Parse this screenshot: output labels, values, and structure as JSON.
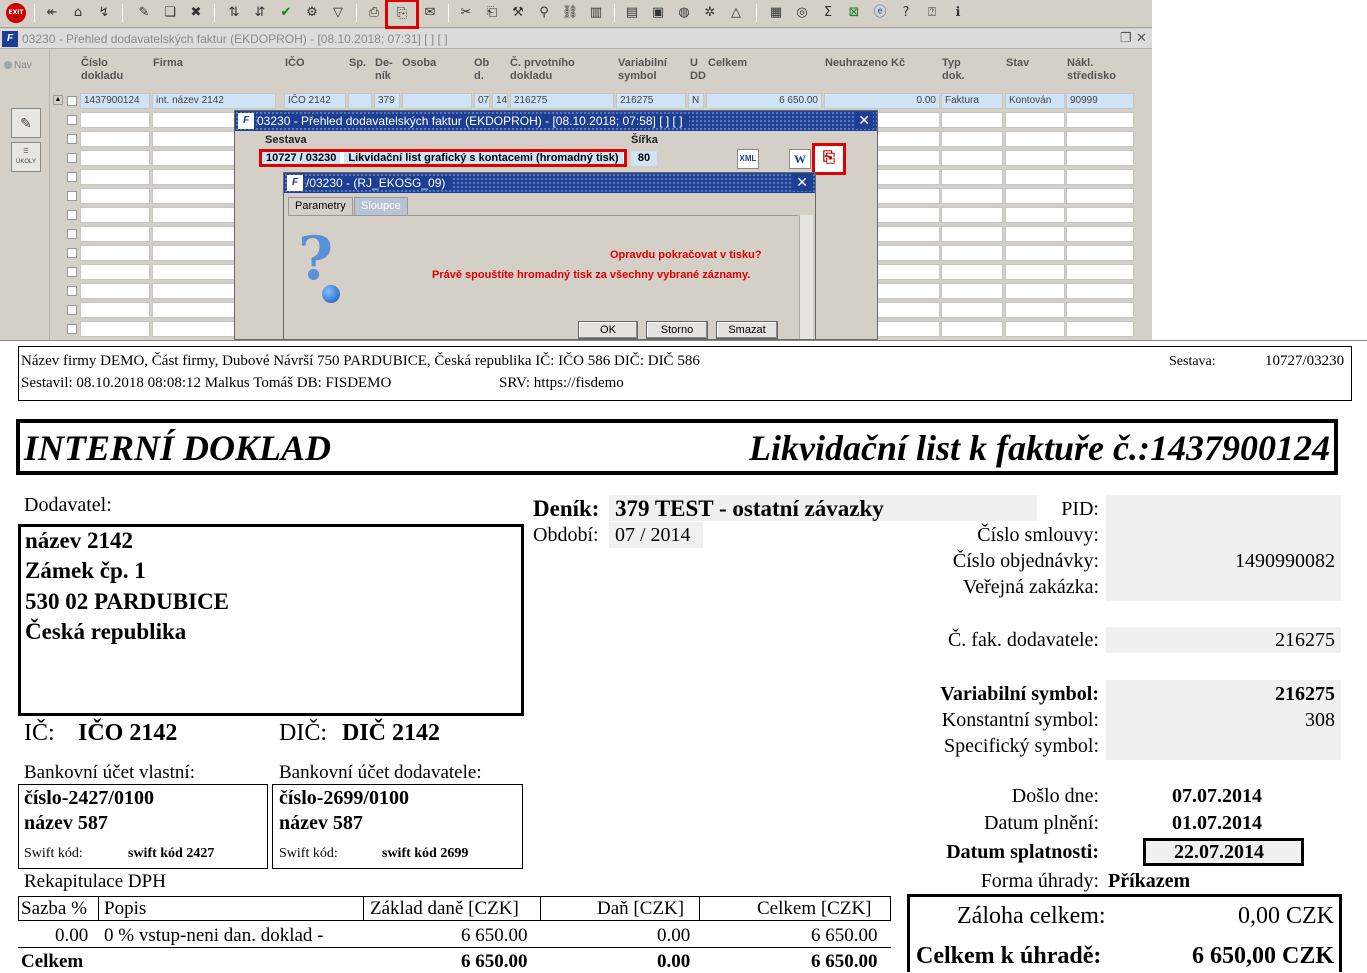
{
  "toolbar": {
    "exit_label": "EXIT",
    "icons": [
      "back-icon",
      "forward-icon",
      "refresh-icon",
      "edit-icon",
      "new-icon",
      "copy-icon",
      "delete-icon",
      "sort-asc-icon",
      "sort-desc-icon",
      "check-icon",
      "settings-icon",
      "filter-icon",
      "print-icon",
      "print-preview-icon",
      "mail-icon",
      "cut-icon",
      "paste-icon",
      "tools-icon",
      "search-icon",
      "link-icon",
      "columns-icon",
      "export-icon",
      "save-icon",
      "globe-icon",
      "tree-icon",
      "chart-icon",
      "report-icon",
      "calc-icon",
      "sum-icon",
      "excel-icon",
      "ie-icon",
      "help-icon",
      "help2-icon",
      "info-icon"
    ]
  },
  "window": {
    "title": "03230 - Přehled dodavatelských faktur (EKDOPROH) - [08.10.2018; 07:31]  [ ]  [ ]",
    "nav_label": "Nav",
    "ukoly_label": "ÚKOLY"
  },
  "grid": {
    "headers": [
      "Číslo\ndokladu",
      "Firma",
      "IČO",
      "Sp.",
      "De-\nník",
      "Osoba",
      "Ob\nd.",
      "Č. prvotního\ndokladu",
      "Variabilní\nsymbol",
      "U\nDD",
      "Celkem",
      "Neuhrazeno Kč",
      "Typ\ndok.",
      "Stav",
      "Nákl.\nstředisko"
    ],
    "row": [
      "1437900124",
      "int. název 2142",
      "IČO 2142",
      "",
      "379",
      "",
      "07",
      "14",
      "216275",
      "216275",
      "N",
      "6 650.00",
      "0.00",
      "Faktura",
      "Kontován",
      "90999"
    ]
  },
  "dialog1": {
    "title": "03230 - Přehled dodavatelských faktur (EKDOPROH) - [08.10.2018; 07:58]  [ ]  [ ]",
    "sestava_label": "Sestava",
    "sirka_label": "Šířka",
    "sestava_code": "10727 / 03230",
    "sestava_name": "Likvidační list grafický s kontacemi (hromadný tisk)",
    "sirka_value": "80",
    "xml_label": "XML",
    "word_label": "W"
  },
  "dialog2": {
    "title": "/03230 - (RJ_EKOSG_09)",
    "tab_parametry": "Parametry",
    "tab_sloupce": "Sloupce",
    "msg1": "Opravdu pokračovat v tisku?",
    "msg2": "Právě spouštíte hromadný tisk za všechny vybrané záznamy.",
    "ok": "OK",
    "storno": "Storno",
    "smazat": "Smazat"
  },
  "doc": {
    "hdr_line1": "Název firmy DEMO, Část firmy, Dubové Návrší 750 PARDUBICE, Česká republika  IČ: IČO 586  DIČ: DIČ 586",
    "hdr_sestava_label": "Sestava:",
    "hdr_sestava_value": "10727/03230",
    "hdr_line2": "Sestavil: 08.10.2018 08:08:12 Malkus Tomáš  DB: FISDEMO",
    "hdr_srv": "SRV: https://fisdemo",
    "title_left": "INTERNÍ DOKLAD",
    "title_right": "Likvidační list k faktuře č.:1437900124",
    "dodavatel_label": "Dodavatel:",
    "addr": [
      "název 2142",
      "Zámek čp. 1",
      "530 02 PARDUBICE",
      "Česká republika"
    ],
    "ic_label": "IČ:",
    "ic_value": "IČO 2142",
    "dic_label": "DIČ:",
    "dic_value": "DIČ 2142",
    "bank_own_label": "Bankovní účet vlastní:",
    "bank_own_number": "číslo-2427/0100",
    "bank_own_name": "název 587",
    "bank_sup_label": "Bankovní účet dodavatele:",
    "bank_sup_number": "číslo-2699/0100",
    "bank_sup_name": "název 587",
    "swift_label": "Swift kód:",
    "swift_own": "swift kód 2427",
    "swift_sup": "swift kód 2699",
    "rekap_label": "Rekapitulace DPH",
    "dph_headers": [
      "Sazba %",
      "Popis",
      "Základ daně [CZK]",
      "Daň [CZK]",
      "Celkem [CZK]"
    ],
    "dph_row": [
      "0.00",
      "0 % vstup-neni dan. doklad -",
      "6 650.00",
      "0.00",
      "6 650.00"
    ],
    "dph_total": [
      "Celkem",
      "6 650.00",
      "0.00",
      "6 650.00"
    ],
    "denik_label": "Deník:",
    "denik_value": "379 TEST - ostatní závazky",
    "obdobi_label": "Období:",
    "obdobi_value": "07 / 2014",
    "pid_label": "PID:",
    "smlouva_label": "Číslo smlouvy:",
    "objednavka_label": "Číslo objednávky:",
    "objednavka_value": "1490990082",
    "zakazka_label": "Veřejná zakázka:",
    "cfak_label": "Č. fak. dodavatele:",
    "cfak_value": "216275",
    "vs_label": "Variabilní symbol:",
    "vs_value": "216275",
    "ks_label": "Konstantní symbol:",
    "ks_value": "308",
    "ss_label": "Specifický symbol:",
    "doslo_label": "Došlo dne:",
    "doslo_value": "07.07.2014",
    "plneni_label": "Datum plnění:",
    "plneni_value": "01.07.2014",
    "splatnost_label": "Datum splatnosti:",
    "splatnost_value": "22.07.2014",
    "uhrada_label": "Forma úhrady:",
    "uhrada_value": "Příkazem",
    "zaloha_label": "Záloha celkem:",
    "zaloha_value": "0,00 CZK",
    "celkem_label": "Celkem k úhradě:",
    "celkem_value": "6 650,00 CZK"
  }
}
